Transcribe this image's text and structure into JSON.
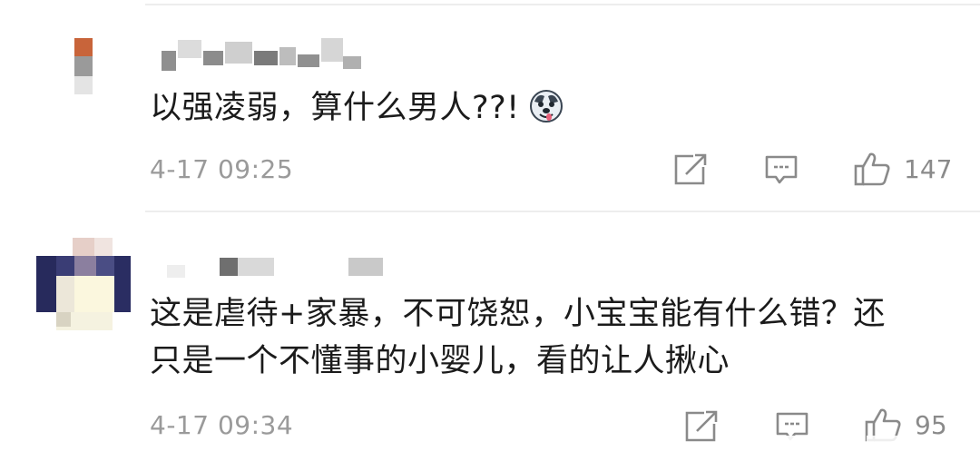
{
  "comments": [
    {
      "text": "以强凌弱，算什么男人??!",
      "emoji_icon": "husky-face-emoji",
      "timestamp": "4-17 09:25",
      "actions": {
        "repost_icon": "share-edit-icon",
        "comment_icon": "comment-bubble-icon",
        "like_icon": "thumbs-up-icon",
        "like_count": "147"
      }
    },
    {
      "text_line1": "这是虐待+家暴，不可饶恕，小宝宝能有什么错？还",
      "text_line2": "只是一个不懂事的小婴儿，看的让人揪心",
      "timestamp": "4-17 09:34",
      "actions": {
        "repost_icon": "share-edit-icon",
        "comment_icon": "comment-bubble-icon",
        "like_icon": "thumbs-up-icon",
        "like_count": "95"
      }
    }
  ],
  "colors": {
    "text": "#1b1b1b",
    "meta": "#9a9a9a",
    "icon": "#8a8a8a",
    "divider": "#ededed"
  }
}
